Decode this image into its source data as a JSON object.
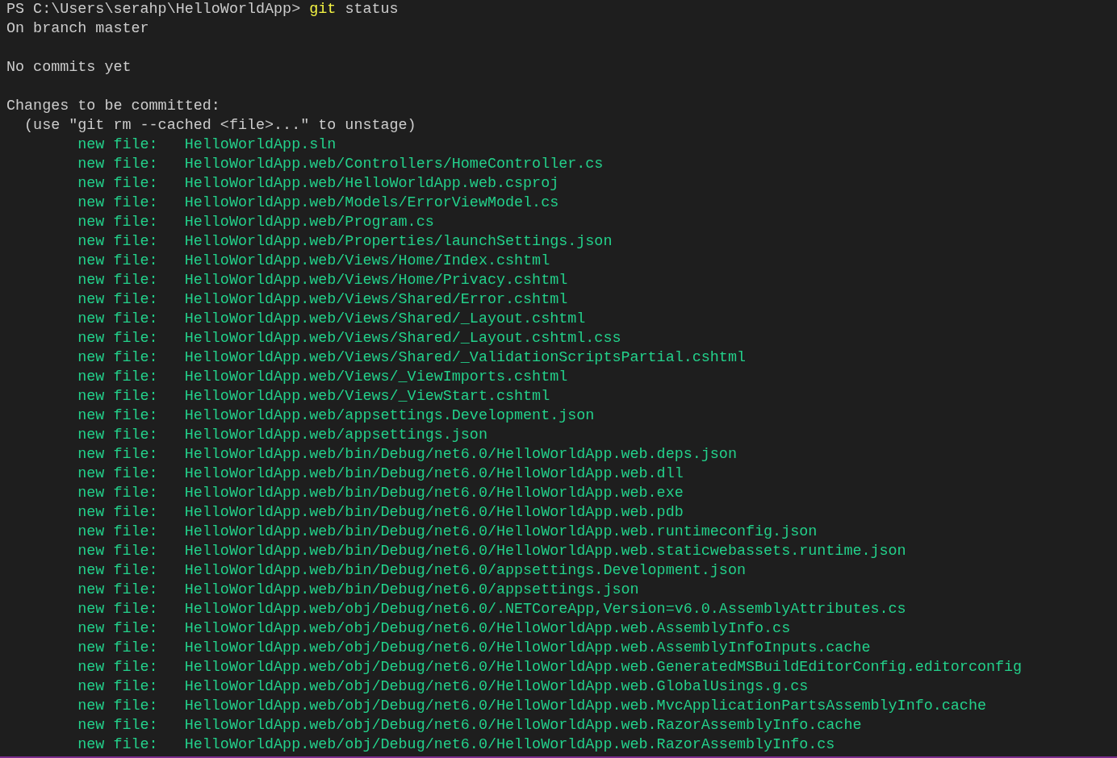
{
  "prompt": {
    "location": "PS C:\\Users\\serahp\\HelloWorldApp>",
    "command": "git",
    "args": "status"
  },
  "output": [
    {
      "kind": "text",
      "text": "On branch master"
    },
    {
      "kind": "blank"
    },
    {
      "kind": "text",
      "text": "No commits yet"
    },
    {
      "kind": "blank"
    },
    {
      "kind": "text",
      "text": "Changes to be committed:"
    },
    {
      "kind": "hint",
      "text": "(use \"git rm --cached <file>...\" to unstage)"
    }
  ],
  "entries": [
    {
      "status": "new file:",
      "path": "HelloWorldApp.sln"
    },
    {
      "status": "new file:",
      "path": "HelloWorldApp.web/Controllers/HomeController.cs"
    },
    {
      "status": "new file:",
      "path": "HelloWorldApp.web/HelloWorldApp.web.csproj"
    },
    {
      "status": "new file:",
      "path": "HelloWorldApp.web/Models/ErrorViewModel.cs"
    },
    {
      "status": "new file:",
      "path": "HelloWorldApp.web/Program.cs"
    },
    {
      "status": "new file:",
      "path": "HelloWorldApp.web/Properties/launchSettings.json"
    },
    {
      "status": "new file:",
      "path": "HelloWorldApp.web/Views/Home/Index.cshtml"
    },
    {
      "status": "new file:",
      "path": "HelloWorldApp.web/Views/Home/Privacy.cshtml"
    },
    {
      "status": "new file:",
      "path": "HelloWorldApp.web/Views/Shared/Error.cshtml"
    },
    {
      "status": "new file:",
      "path": "HelloWorldApp.web/Views/Shared/_Layout.cshtml"
    },
    {
      "status": "new file:",
      "path": "HelloWorldApp.web/Views/Shared/_Layout.cshtml.css"
    },
    {
      "status": "new file:",
      "path": "HelloWorldApp.web/Views/Shared/_ValidationScriptsPartial.cshtml"
    },
    {
      "status": "new file:",
      "path": "HelloWorldApp.web/Views/_ViewImports.cshtml"
    },
    {
      "status": "new file:",
      "path": "HelloWorldApp.web/Views/_ViewStart.cshtml"
    },
    {
      "status": "new file:",
      "path": "HelloWorldApp.web/appsettings.Development.json"
    },
    {
      "status": "new file:",
      "path": "HelloWorldApp.web/appsettings.json"
    },
    {
      "status": "new file:",
      "path": "HelloWorldApp.web/bin/Debug/net6.0/HelloWorldApp.web.deps.json"
    },
    {
      "status": "new file:",
      "path": "HelloWorldApp.web/bin/Debug/net6.0/HelloWorldApp.web.dll"
    },
    {
      "status": "new file:",
      "path": "HelloWorldApp.web/bin/Debug/net6.0/HelloWorldApp.web.exe"
    },
    {
      "status": "new file:",
      "path": "HelloWorldApp.web/bin/Debug/net6.0/HelloWorldApp.web.pdb"
    },
    {
      "status": "new file:",
      "path": "HelloWorldApp.web/bin/Debug/net6.0/HelloWorldApp.web.runtimeconfig.json"
    },
    {
      "status": "new file:",
      "path": "HelloWorldApp.web/bin/Debug/net6.0/HelloWorldApp.web.staticwebassets.runtime.json"
    },
    {
      "status": "new file:",
      "path": "HelloWorldApp.web/bin/Debug/net6.0/appsettings.Development.json"
    },
    {
      "status": "new file:",
      "path": "HelloWorldApp.web/bin/Debug/net6.0/appsettings.json"
    },
    {
      "status": "new file:",
      "path": "HelloWorldApp.web/obj/Debug/net6.0/.NETCoreApp,Version=v6.0.AssemblyAttributes.cs"
    },
    {
      "status": "new file:",
      "path": "HelloWorldApp.web/obj/Debug/net6.0/HelloWorldApp.web.AssemblyInfo.cs"
    },
    {
      "status": "new file:",
      "path": "HelloWorldApp.web/obj/Debug/net6.0/HelloWorldApp.web.AssemblyInfoInputs.cache"
    },
    {
      "status": "new file:",
      "path": "HelloWorldApp.web/obj/Debug/net6.0/HelloWorldApp.web.GeneratedMSBuildEditorConfig.editorconfig"
    },
    {
      "status": "new file:",
      "path": "HelloWorldApp.web/obj/Debug/net6.0/HelloWorldApp.web.GlobalUsings.g.cs"
    },
    {
      "status": "new file:",
      "path": "HelloWorldApp.web/obj/Debug/net6.0/HelloWorldApp.web.MvcApplicationPartsAssemblyInfo.cache"
    },
    {
      "status": "new file:",
      "path": "HelloWorldApp.web/obj/Debug/net6.0/HelloWorldApp.web.RazorAssemblyInfo.cache"
    },
    {
      "status": "new file:",
      "path": "HelloWorldApp.web/obj/Debug/net6.0/HelloWorldApp.web.RazorAssemblyInfo.cs"
    }
  ]
}
